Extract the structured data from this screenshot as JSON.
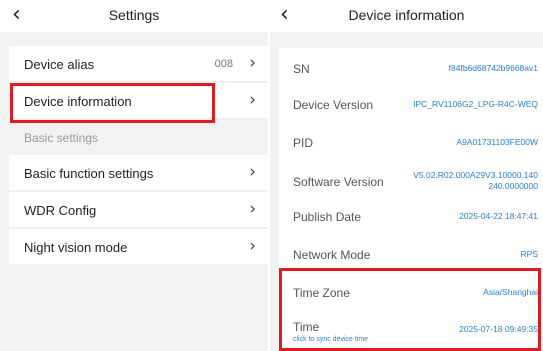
{
  "settings": {
    "title": "Settings",
    "items": [
      {
        "label": "Device alias",
        "value": "008"
      },
      {
        "label": "Device information",
        "value": ""
      }
    ],
    "section_label": "Basic settings",
    "section_items": [
      {
        "label": "Basic function settings"
      },
      {
        "label": "WDR Config"
      },
      {
        "label": "Night vision mode"
      }
    ]
  },
  "device_info": {
    "title": "Device information",
    "rows": [
      {
        "label": "SN",
        "value": "f84fb6d68742b9668av1"
      },
      {
        "label": "Device Version",
        "value": "IPC_RV1106G2_LPG-R4C-WEQ"
      },
      {
        "label": "PID",
        "value": "A9A01731103FE00W"
      },
      {
        "label": "Software Version",
        "value_line1": "V5.02.R02.000A29V3.10000.140",
        "value_line2": "240.0000000"
      },
      {
        "label": "Publish Date",
        "value": "2025-04-22 18:47:41"
      },
      {
        "label": "Network Mode",
        "value": "RPS"
      },
      {
        "label": "Time Zone",
        "value": "Asia/Shanghai"
      },
      {
        "label": "Time",
        "sub": "click to sync device time",
        "value": "2025-07-18 09:49:35"
      }
    ]
  },
  "colors": {
    "highlight": "#e11b22",
    "link": "#2a7fd4",
    "background": "#f2f2f2"
  }
}
